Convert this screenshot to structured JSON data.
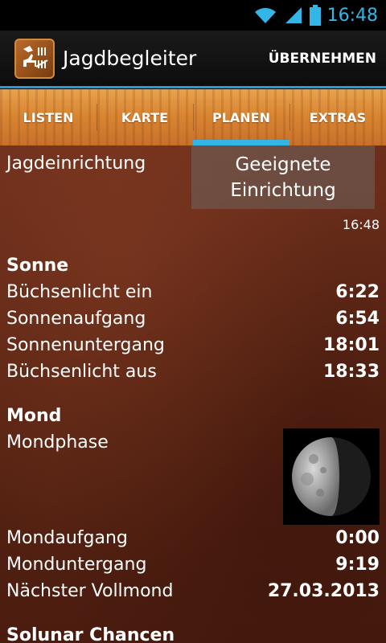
{
  "status": {
    "time": "16:48"
  },
  "header": {
    "title": "Jagdbegleiter",
    "action": "ÜBERNEHMEN"
  },
  "tabs": [
    {
      "label": "LISTEN",
      "active": false
    },
    {
      "label": "KARTE",
      "active": false
    },
    {
      "label": "PLANEN",
      "active": true
    },
    {
      "label": "EXTRAS",
      "active": false
    }
  ],
  "facility": {
    "label": "Jagdeinrichtung",
    "button_line1": "Geeignete",
    "button_line2": "Einrichtung",
    "time": "16:48"
  },
  "sun": {
    "title": "Sonne",
    "rows": [
      {
        "label": "Büchsenlicht ein",
        "value": "6:22"
      },
      {
        "label": "Sonnenaufgang",
        "value": "6:54"
      },
      {
        "label": "Sonnenuntergang",
        "value": "18:01"
      },
      {
        "label": "Büchsenlicht aus",
        "value": "18:33"
      }
    ]
  },
  "moon": {
    "title": "Mond",
    "phase_label": "Mondphase",
    "rows": [
      {
        "label": "Mondaufgang",
        "value": "0:00"
      },
      {
        "label": "Monduntergang",
        "value": "9:19"
      },
      {
        "label": "Nächster Vollmond",
        "value": "27.03.2013"
      }
    ]
  },
  "solunar": {
    "title": "Solunar Chancen"
  },
  "colors": {
    "accent": "#33b5e5",
    "tab_wood": "#d98632",
    "leather": "#5a2514"
  }
}
